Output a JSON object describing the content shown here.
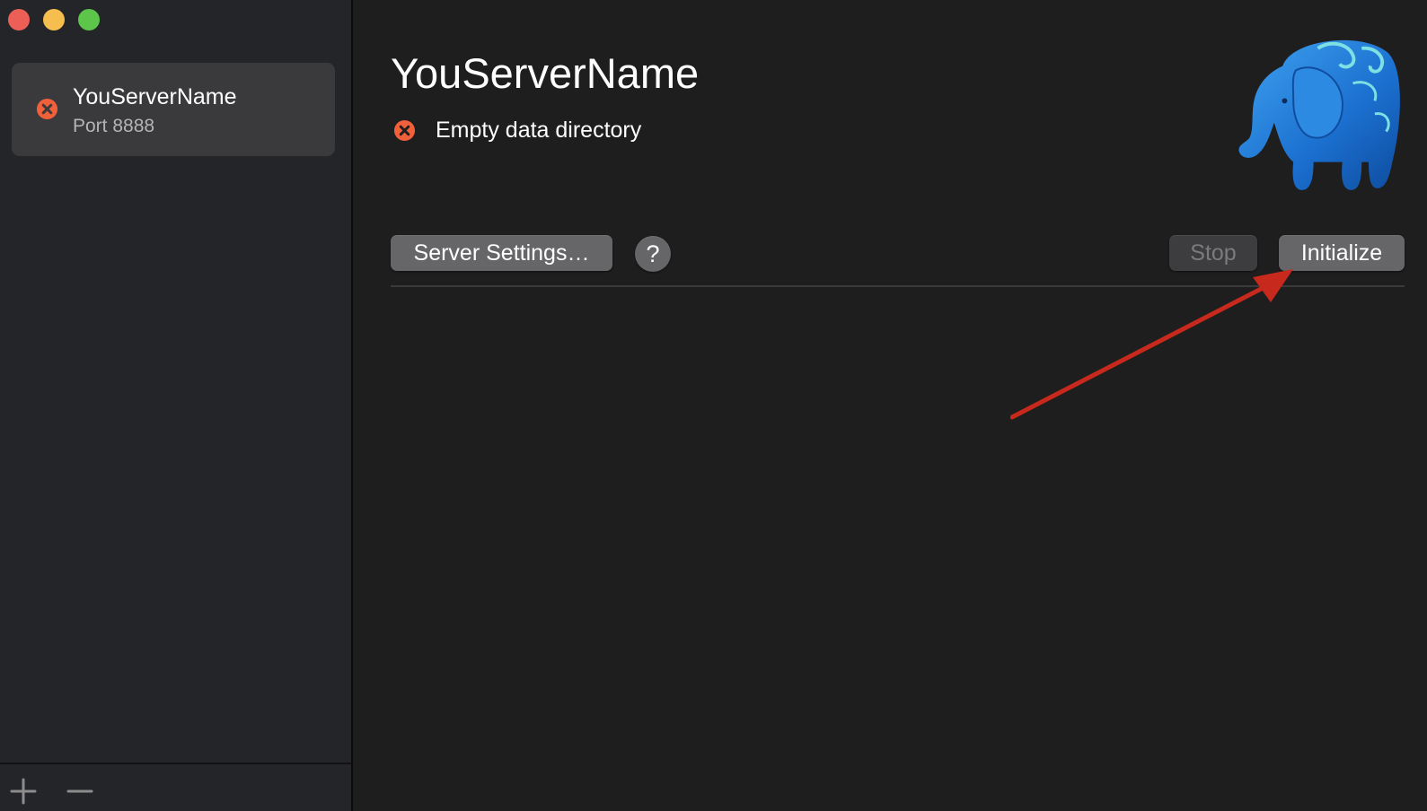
{
  "window": {
    "controls": [
      "close",
      "minimize",
      "maximize"
    ]
  },
  "sidebar": {
    "servers": [
      {
        "name": "YouServerName",
        "port_label": "Port 8888",
        "status_icon": "error-icon"
      }
    ],
    "footer": {
      "add_icon": "plus-icon",
      "remove_icon": "minus-icon"
    }
  },
  "main": {
    "title": "YouServerName",
    "status": {
      "icon": "error-icon",
      "message": "Empty data directory"
    },
    "buttons": {
      "settings": "Server Settings…",
      "help": "?",
      "stop": "Stop",
      "initialize": "Initialize"
    },
    "logo": "postgres-elephant",
    "annotation": "red-arrow-pointing-to-initialize"
  },
  "colors": {
    "error": "#f0603a",
    "annotation_arrow": "#c7291c",
    "elephant": "#1f7fd6"
  }
}
